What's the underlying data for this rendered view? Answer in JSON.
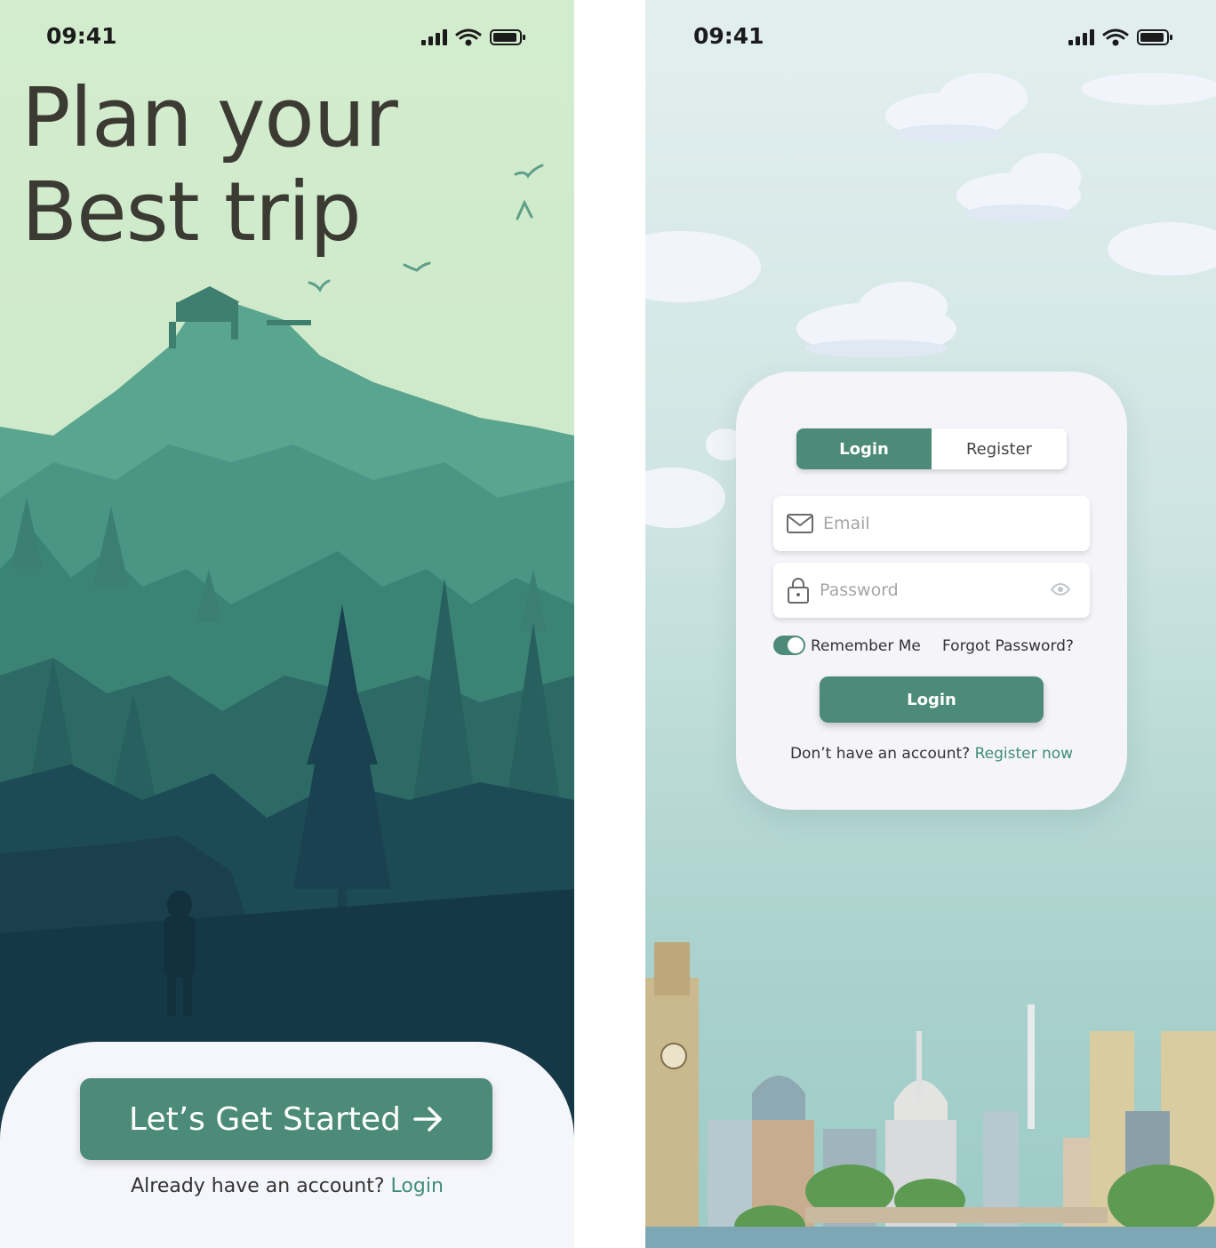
{
  "screen_welcome": {
    "status_bar": {
      "time": "09:41"
    },
    "hero_title_line1": "Plan your",
    "hero_title_line2": "Best trip",
    "cta_label": "Let’s Get Started",
    "signin_prompt": "Already have an account?",
    "signin_link": "Login",
    "colors": {
      "accent": "#4c8b77",
      "sky": "#d3ecce",
      "sheet": "#f5f6fb"
    }
  },
  "screen_login": {
    "status_bar": {
      "time": "09:41"
    },
    "tabs": [
      {
        "label": "Login",
        "active": true
      },
      {
        "label": "Register",
        "active": false
      }
    ],
    "email": {
      "placeholder": "Email",
      "value": "",
      "icon": "mail-icon"
    },
    "password": {
      "placeholder": "Password",
      "value": "",
      "icon": "lock-icon",
      "toggle_icon": "eye-icon"
    },
    "remember_me": {
      "label": "Remember Me",
      "checked": true
    },
    "forgot_password": "Forgot Password?",
    "login_button": "Login",
    "register_prompt": "Don’t have an account?",
    "register_link": "Register now",
    "colors": {
      "accent": "#4c8b77",
      "card": "#f4f4f9"
    }
  }
}
